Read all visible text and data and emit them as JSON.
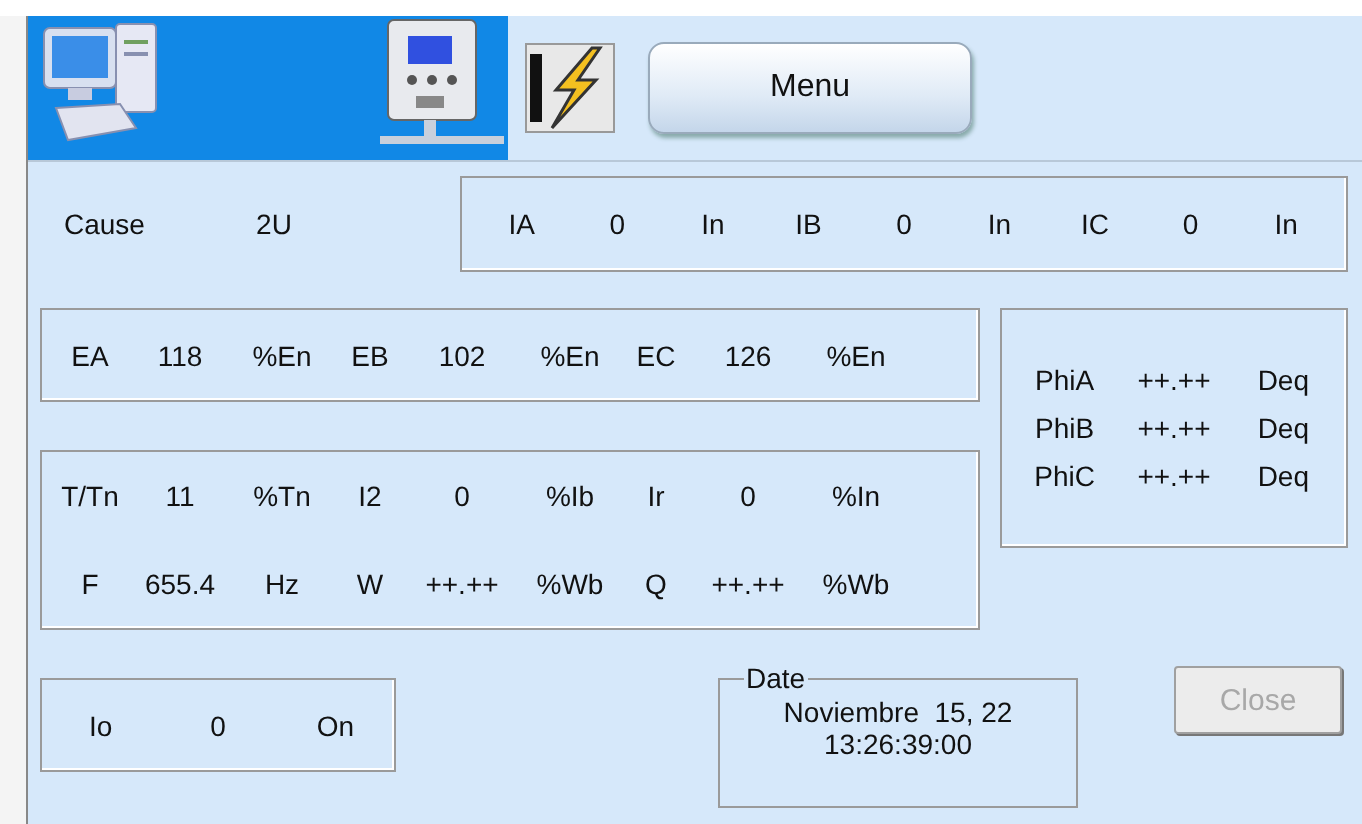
{
  "header": {
    "menu_button": "Menu"
  },
  "cause": {
    "label": "Cause",
    "value": "2U"
  },
  "currents": [
    {
      "label": "IA",
      "value": "0",
      "unit": "In"
    },
    {
      "label": "IB",
      "value": "0",
      "unit": "In"
    },
    {
      "label": "IC",
      "value": "0",
      "unit": "In"
    }
  ],
  "voltages": [
    {
      "label": "EA",
      "value": "118",
      "unit": "%En"
    },
    {
      "label": "EB",
      "value": "102",
      "unit": "%En"
    },
    {
      "label": "EC",
      "value": "126",
      "unit": "%En"
    }
  ],
  "phases": [
    {
      "label": "PhiA",
      "value": "++.++",
      "unit": "Deq"
    },
    {
      "label": "PhiB",
      "value": "++.++",
      "unit": "Deq"
    },
    {
      "label": "PhiC",
      "value": "++.++",
      "unit": "Deq"
    }
  ],
  "measures": [
    [
      {
        "label": "T/Tn",
        "value": "11",
        "unit": "%Tn"
      },
      {
        "label": "I2",
        "value": "0",
        "unit": "%Ib"
      },
      {
        "label": "Ir",
        "value": "0",
        "unit": "%In"
      }
    ],
    [
      {
        "label": "F",
        "value": "655.4",
        "unit": "Hz"
      },
      {
        "label": "W",
        "value": "++.++",
        "unit": "%Wb"
      },
      {
        "label": "Q",
        "value": "++.++",
        "unit": "%Wb"
      }
    ]
  ],
  "residual": {
    "label": "Io",
    "value": "0",
    "unit": "On"
  },
  "date": {
    "legend": "Date",
    "lines": [
      "Noviembre  15, 22",
      "13:26:39:00"
    ]
  },
  "close_button": {
    "label": "Close",
    "disabled": true
  }
}
